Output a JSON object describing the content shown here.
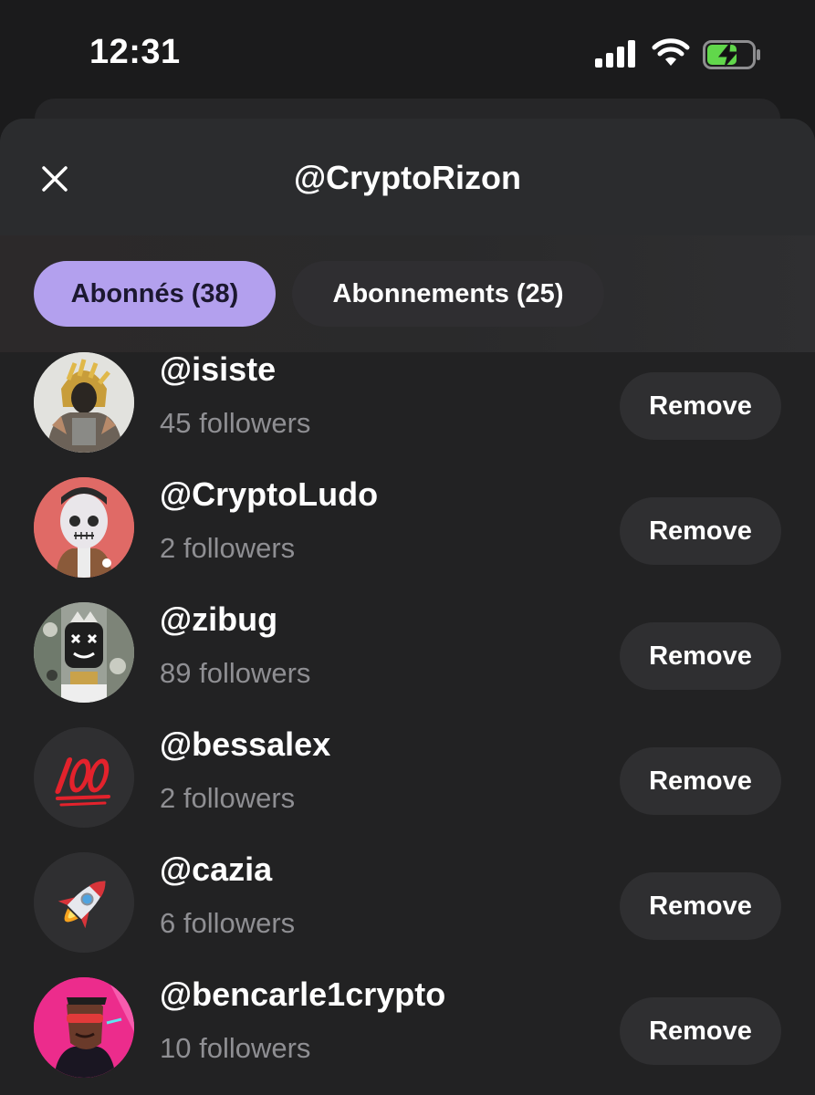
{
  "status_bar": {
    "time": "12:31",
    "icons": [
      "signal-icon",
      "wifi-icon",
      "battery-charging-icon"
    ]
  },
  "sheet": {
    "title": "@CryptoRizon",
    "close_icon": "close-icon"
  },
  "tabs": [
    {
      "label": "Abonnés (38)",
      "active": true
    },
    {
      "label": "Abonnements (25)",
      "active": false
    }
  ],
  "colors": {
    "accent": "#b3a0ee",
    "background": "#1b1b1c",
    "secondary_text": "#8f8f93",
    "button_bg": "#2f2f31"
  },
  "followers": [
    {
      "username": "@isiste",
      "followers": "45 followers",
      "action": "Remove",
      "avatar": "warrior-avatar"
    },
    {
      "username": "@CryptoLudo",
      "followers": "2 followers",
      "action": "Remove",
      "avatar": "skull-boy-avatar"
    },
    {
      "username": "@zibug",
      "followers": "89 followers",
      "action": "Remove",
      "avatar": "xx-face-avatar"
    },
    {
      "username": "@bessalex",
      "followers": "2 followers",
      "action": "Remove",
      "avatar": "hundred-emoji-avatar"
    },
    {
      "username": "@cazia",
      "followers": "6 followers",
      "action": "Remove",
      "avatar": "rocket-emoji-avatar"
    },
    {
      "username": "@bencarle1crypto",
      "followers": "10 followers",
      "action": "Remove",
      "avatar": "cyberpunk-avatar"
    }
  ]
}
